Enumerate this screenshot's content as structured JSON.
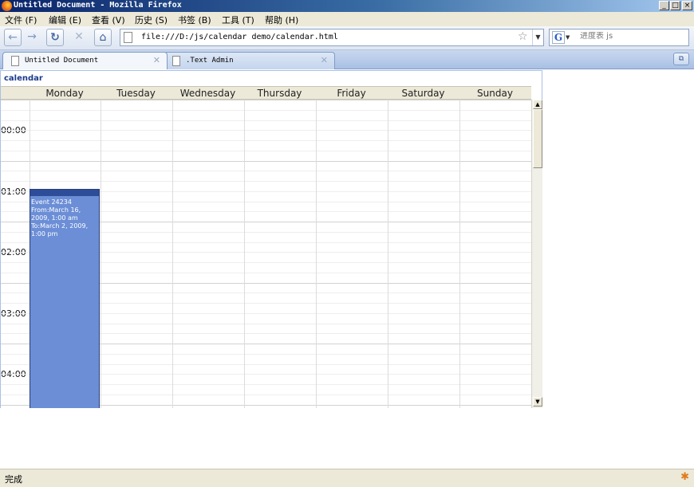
{
  "window": {
    "title": "Untitled Document - Mozilla Firefox",
    "controls": {
      "minimize": "_",
      "maximize": "□",
      "close": "×"
    }
  },
  "menubar": {
    "items": [
      "文件 (F)",
      "编辑 (E)",
      "查看 (V)",
      "历史 (S)",
      "书签 (B)",
      "工具 (T)",
      "帮助 (H)"
    ]
  },
  "navbar": {
    "back_icon": "arrow-left-icon",
    "forward_icon": "arrow-right-icon",
    "url": "file:///D:/js/calendar demo/calendar.html",
    "search_placeholder": "进度表 js",
    "search_engine_letter": "G"
  },
  "tabs": [
    {
      "label": "Untitled Document",
      "active": true
    },
    {
      "label": ".Text Admin",
      "active": false
    }
  ],
  "calendar": {
    "title": "calendar",
    "days": [
      "Monday",
      "Tuesday",
      "Wednesday",
      "Thursday",
      "Friday",
      "Saturday",
      "Sunday"
    ],
    "times": [
      "00:00",
      "01:00",
      "02:00",
      "03:00",
      "04:00"
    ],
    "event": {
      "title": "Event 24234",
      "from": "From:March 16, 2009, 1:00 am",
      "to": "To:March 2, 2009, 1:00 pm",
      "color": "#6b8ed6",
      "header_color": "#2e4d99"
    }
  },
  "statusbar": {
    "text": "完成"
  }
}
